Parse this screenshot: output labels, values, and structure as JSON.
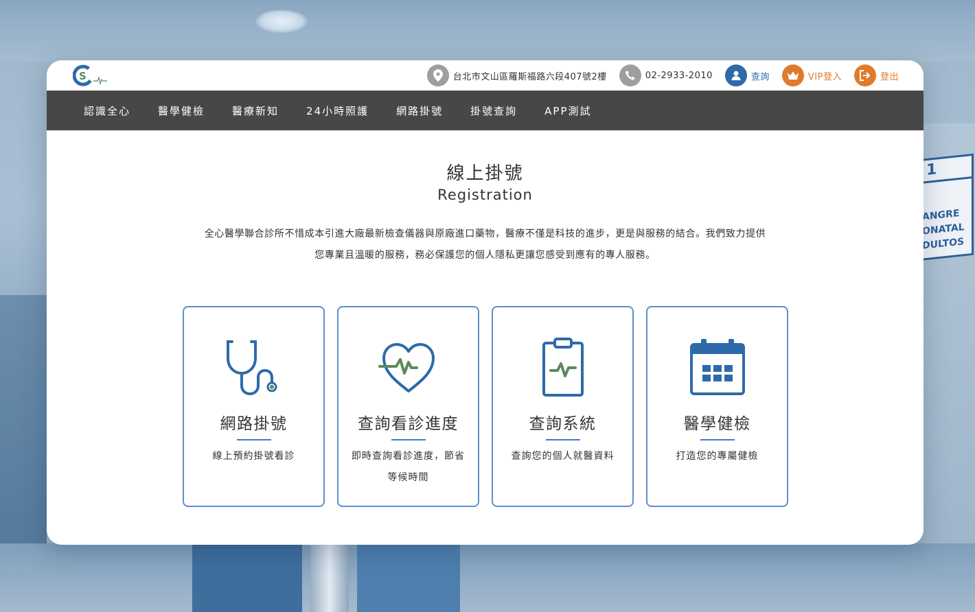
{
  "header": {
    "address": "台北市文山區羅斯福路六段407號2樓",
    "phone": "02-2933-2010",
    "query_label": "查詢",
    "vip_label": "VIP登入",
    "logout_label": "登出"
  },
  "nav": {
    "items": [
      {
        "label": "認識全心"
      },
      {
        "label": "醫學健檢"
      },
      {
        "label": "醫療新知"
      },
      {
        "label": "24小時照護"
      },
      {
        "label": "網路掛號"
      },
      {
        "label": "掛號查詢"
      },
      {
        "label": "APP測試"
      }
    ]
  },
  "main": {
    "title_zh": "線上掛號",
    "title_en": "Registration",
    "intro_line1": "全心醫學聯合診所不惜成本引進大廠最新檢查儀器與原廠進口藥物，醫療不僅是科技的進步，更是與服務的結合。我們致力提供",
    "intro_line2": "您專業且溫暖的服務，務必保護您的個人隱私更讓您感受到應有的專人服務。"
  },
  "cards": [
    {
      "title": "網路掛號",
      "desc": "線上預約掛號看診",
      "icon": "stethoscope-icon"
    },
    {
      "title": "查詢看診進度",
      "desc": "即時查詢看診進度，節省等候時間",
      "icon": "heart-pulse-icon"
    },
    {
      "title": "查詢系統",
      "desc": "查詢您的個人就醫資料",
      "icon": "clipboard-pulse-icon"
    },
    {
      "title": "醫學健檢",
      "desc": "打造您的專屬健檢",
      "icon": "calendar-icon"
    }
  ],
  "background_sign": {
    "number": "1",
    "lines": [
      "ANGRE",
      "ONATAL",
      "DULTOS"
    ]
  },
  "colors": {
    "nav_bg": "#474747",
    "accent_blue": "#2e6aaa",
    "accent_green": "#5a8a5c",
    "accent_orange": "#e07a2c",
    "card_border": "#5b8fca"
  }
}
